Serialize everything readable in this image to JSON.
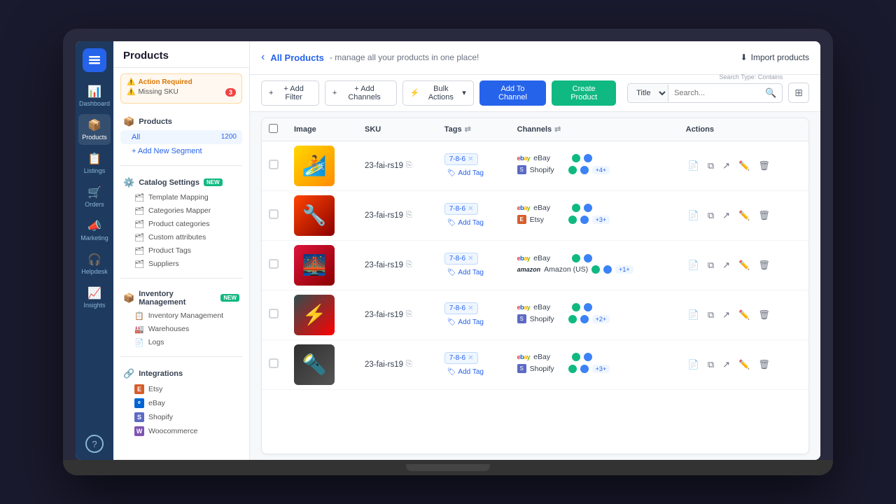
{
  "app": {
    "name": "Products"
  },
  "sidebar": {
    "header": "Products",
    "alert": {
      "title": "Action Required",
      "items": [
        {
          "label": "Missing SKU",
          "count": 3
        }
      ]
    },
    "segments": {
      "title": "Products",
      "items": [
        {
          "label": "All",
          "count": 1200,
          "active": true
        }
      ],
      "add_segment": "+ Add New Segment"
    },
    "catalog_settings": {
      "title": "Catalog Settings",
      "items": [
        {
          "label": "Template Mapping"
        },
        {
          "label": "Categories Mapper"
        },
        {
          "label": "Product categories"
        },
        {
          "label": "Custom attributes"
        },
        {
          "label": "Product Tags"
        },
        {
          "label": "Suppliers"
        }
      ]
    },
    "inventory": {
      "title": "Inventory Management",
      "items": [
        {
          "label": "Inventory Management"
        },
        {
          "label": "Warehouses"
        },
        {
          "label": "Logs"
        }
      ]
    },
    "integrations": {
      "title": "Integrations",
      "items": [
        {
          "label": "Etsy",
          "type": "etsy"
        },
        {
          "label": "eBay",
          "type": "ebay"
        },
        {
          "label": "Shopify",
          "type": "shopify"
        },
        {
          "label": "Woocommerce",
          "type": "woo"
        }
      ]
    }
  },
  "nav": {
    "items": [
      {
        "label": "Dashboard",
        "icon": "📊",
        "active": false
      },
      {
        "label": "Products",
        "icon": "📦",
        "active": true
      },
      {
        "label": "Listings",
        "icon": "📋",
        "active": false
      },
      {
        "label": "Orders",
        "icon": "🛒",
        "active": false
      },
      {
        "label": "Marketing",
        "icon": "📣",
        "active": false
      },
      {
        "label": "Helpdesk",
        "icon": "🎧",
        "active": false
      },
      {
        "label": "Insights",
        "icon": "📈",
        "active": false
      }
    ]
  },
  "topbar": {
    "back": "‹",
    "page_title": "All Products",
    "subtitle": "- manage all your products in one place!",
    "import_btn": "Import products"
  },
  "toolbar": {
    "add_filter": "+ Add Filter",
    "add_channels": "+ Add Channels",
    "bulk_actions": "Bulk Actions",
    "add_to_channel": "Add To Channel",
    "create_product": "Create Product",
    "search_type": "Title",
    "search_placeholder": "Search...",
    "search_type_label": "Search Type: Contains"
  },
  "table": {
    "columns": [
      "Image",
      "SKU",
      "Tags",
      "Channels",
      "Actions"
    ],
    "rows": [
      {
        "id": 1,
        "sku": "23-fai-rs19",
        "tag": "7-8-6",
        "channels": [
          {
            "name": "eBay",
            "type": "ebay",
            "dots": [
              "green",
              "blue"
            ]
          },
          {
            "name": "Shopify",
            "type": "shopify",
            "dots": [
              "green",
              "blue"
            ],
            "more": "+4+"
          }
        ]
      },
      {
        "id": 2,
        "sku": "23-fai-rs19",
        "tag": "7-8-6",
        "channels": [
          {
            "name": "eBay",
            "type": "ebay",
            "dots": [
              "green",
              "blue"
            ]
          },
          {
            "name": "Etsy",
            "type": "etsy",
            "dots": [
              "green",
              "blue"
            ],
            "more": "+3+"
          }
        ]
      },
      {
        "id": 3,
        "sku": "23-fai-rs19",
        "tag": "7-8-6",
        "channels": [
          {
            "name": "eBay",
            "type": "ebay",
            "dots": [
              "green",
              "blue"
            ]
          },
          {
            "name": "Amazon (US)",
            "type": "amazon",
            "dots": [
              "green",
              "blue"
            ],
            "more": "+1+"
          }
        ]
      },
      {
        "id": 4,
        "sku": "23-fai-rs19",
        "tag": "7-8-6",
        "channels": [
          {
            "name": "eBay",
            "type": "ebay",
            "dots": [
              "green",
              "blue"
            ]
          },
          {
            "name": "Shopify",
            "type": "shopify",
            "dots": [
              "green",
              "blue"
            ],
            "more": "+2+"
          }
        ]
      },
      {
        "id": 5,
        "sku": "23-fai-rs19",
        "tag": "7-8-6",
        "channels": [
          {
            "name": "eBay",
            "type": "ebay",
            "dots": [
              "green",
              "blue"
            ]
          },
          {
            "name": "Shopify",
            "type": "shopify",
            "dots": [
              "green",
              "blue"
            ],
            "more": "+3+"
          }
        ]
      }
    ]
  }
}
